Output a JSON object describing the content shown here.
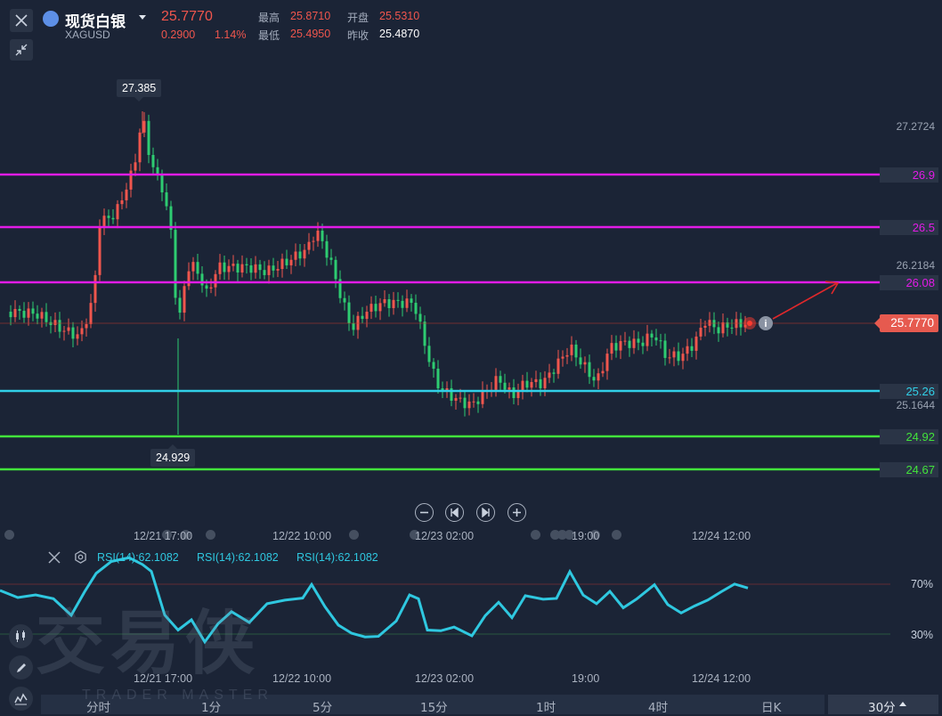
{
  "header": {
    "symbol_name": "现货白银",
    "symbol_code": "XAGUSD",
    "price": "25.7770",
    "change": "0.2900",
    "change_pct": "1.14%",
    "high_label": "最高",
    "high": "25.8710",
    "open_label": "开盘",
    "open": "25.5310",
    "low_label": "最低",
    "low": "25.4950",
    "prev_close_label": "昨收",
    "prev_close": "25.4870"
  },
  "levels": [
    {
      "label": "26.9",
      "color": "#e21be6"
    },
    {
      "label": "26.5",
      "color": "#e21be6"
    },
    {
      "label": "26.08",
      "color": "#e21be6"
    },
    {
      "label": "25.26",
      "color": "#31d0e8"
    },
    {
      "label": "24.92",
      "color": "#42e43b"
    },
    {
      "label": "24.67",
      "color": "#42e43b"
    }
  ],
  "axis": {
    "v1": "27.2724",
    "v2": "26.2184",
    "v3": "25.1644"
  },
  "current_price_tag": "25.7770",
  "markers": {
    "high": "27.385",
    "low": "24.929"
  },
  "time_axis": [
    "12/21 17:00",
    "12/22 10:00",
    "12/23 02:00",
    "19:00",
    "12/24 12:00"
  ],
  "rsi": {
    "labels": [
      "RSI(14):62.1082",
      "RSI(14):62.1082",
      "RSI(14):62.1082"
    ],
    "levels": [
      "70%",
      "30%"
    ]
  },
  "watermark": {
    "main": "交易侠",
    "sub": "TRADER MASTER"
  },
  "periods": [
    "分时",
    "1分",
    "5分",
    "15分",
    "1时",
    "4时",
    "日K"
  ],
  "period_selected": "30分",
  "colors": {
    "up": "#f0564d",
    "down": "#2ecc71",
    "rsi": "#2fc8e0",
    "bg": "#1b2436"
  },
  "icons": [
    "close-icon",
    "collapse-icon",
    "zoom-out-icon",
    "step-back-icon",
    "step-forward-icon",
    "zoom-in-icon",
    "settings-icon",
    "candlestick-icon",
    "pen-icon",
    "indicator-icon",
    "info-icon"
  ]
}
